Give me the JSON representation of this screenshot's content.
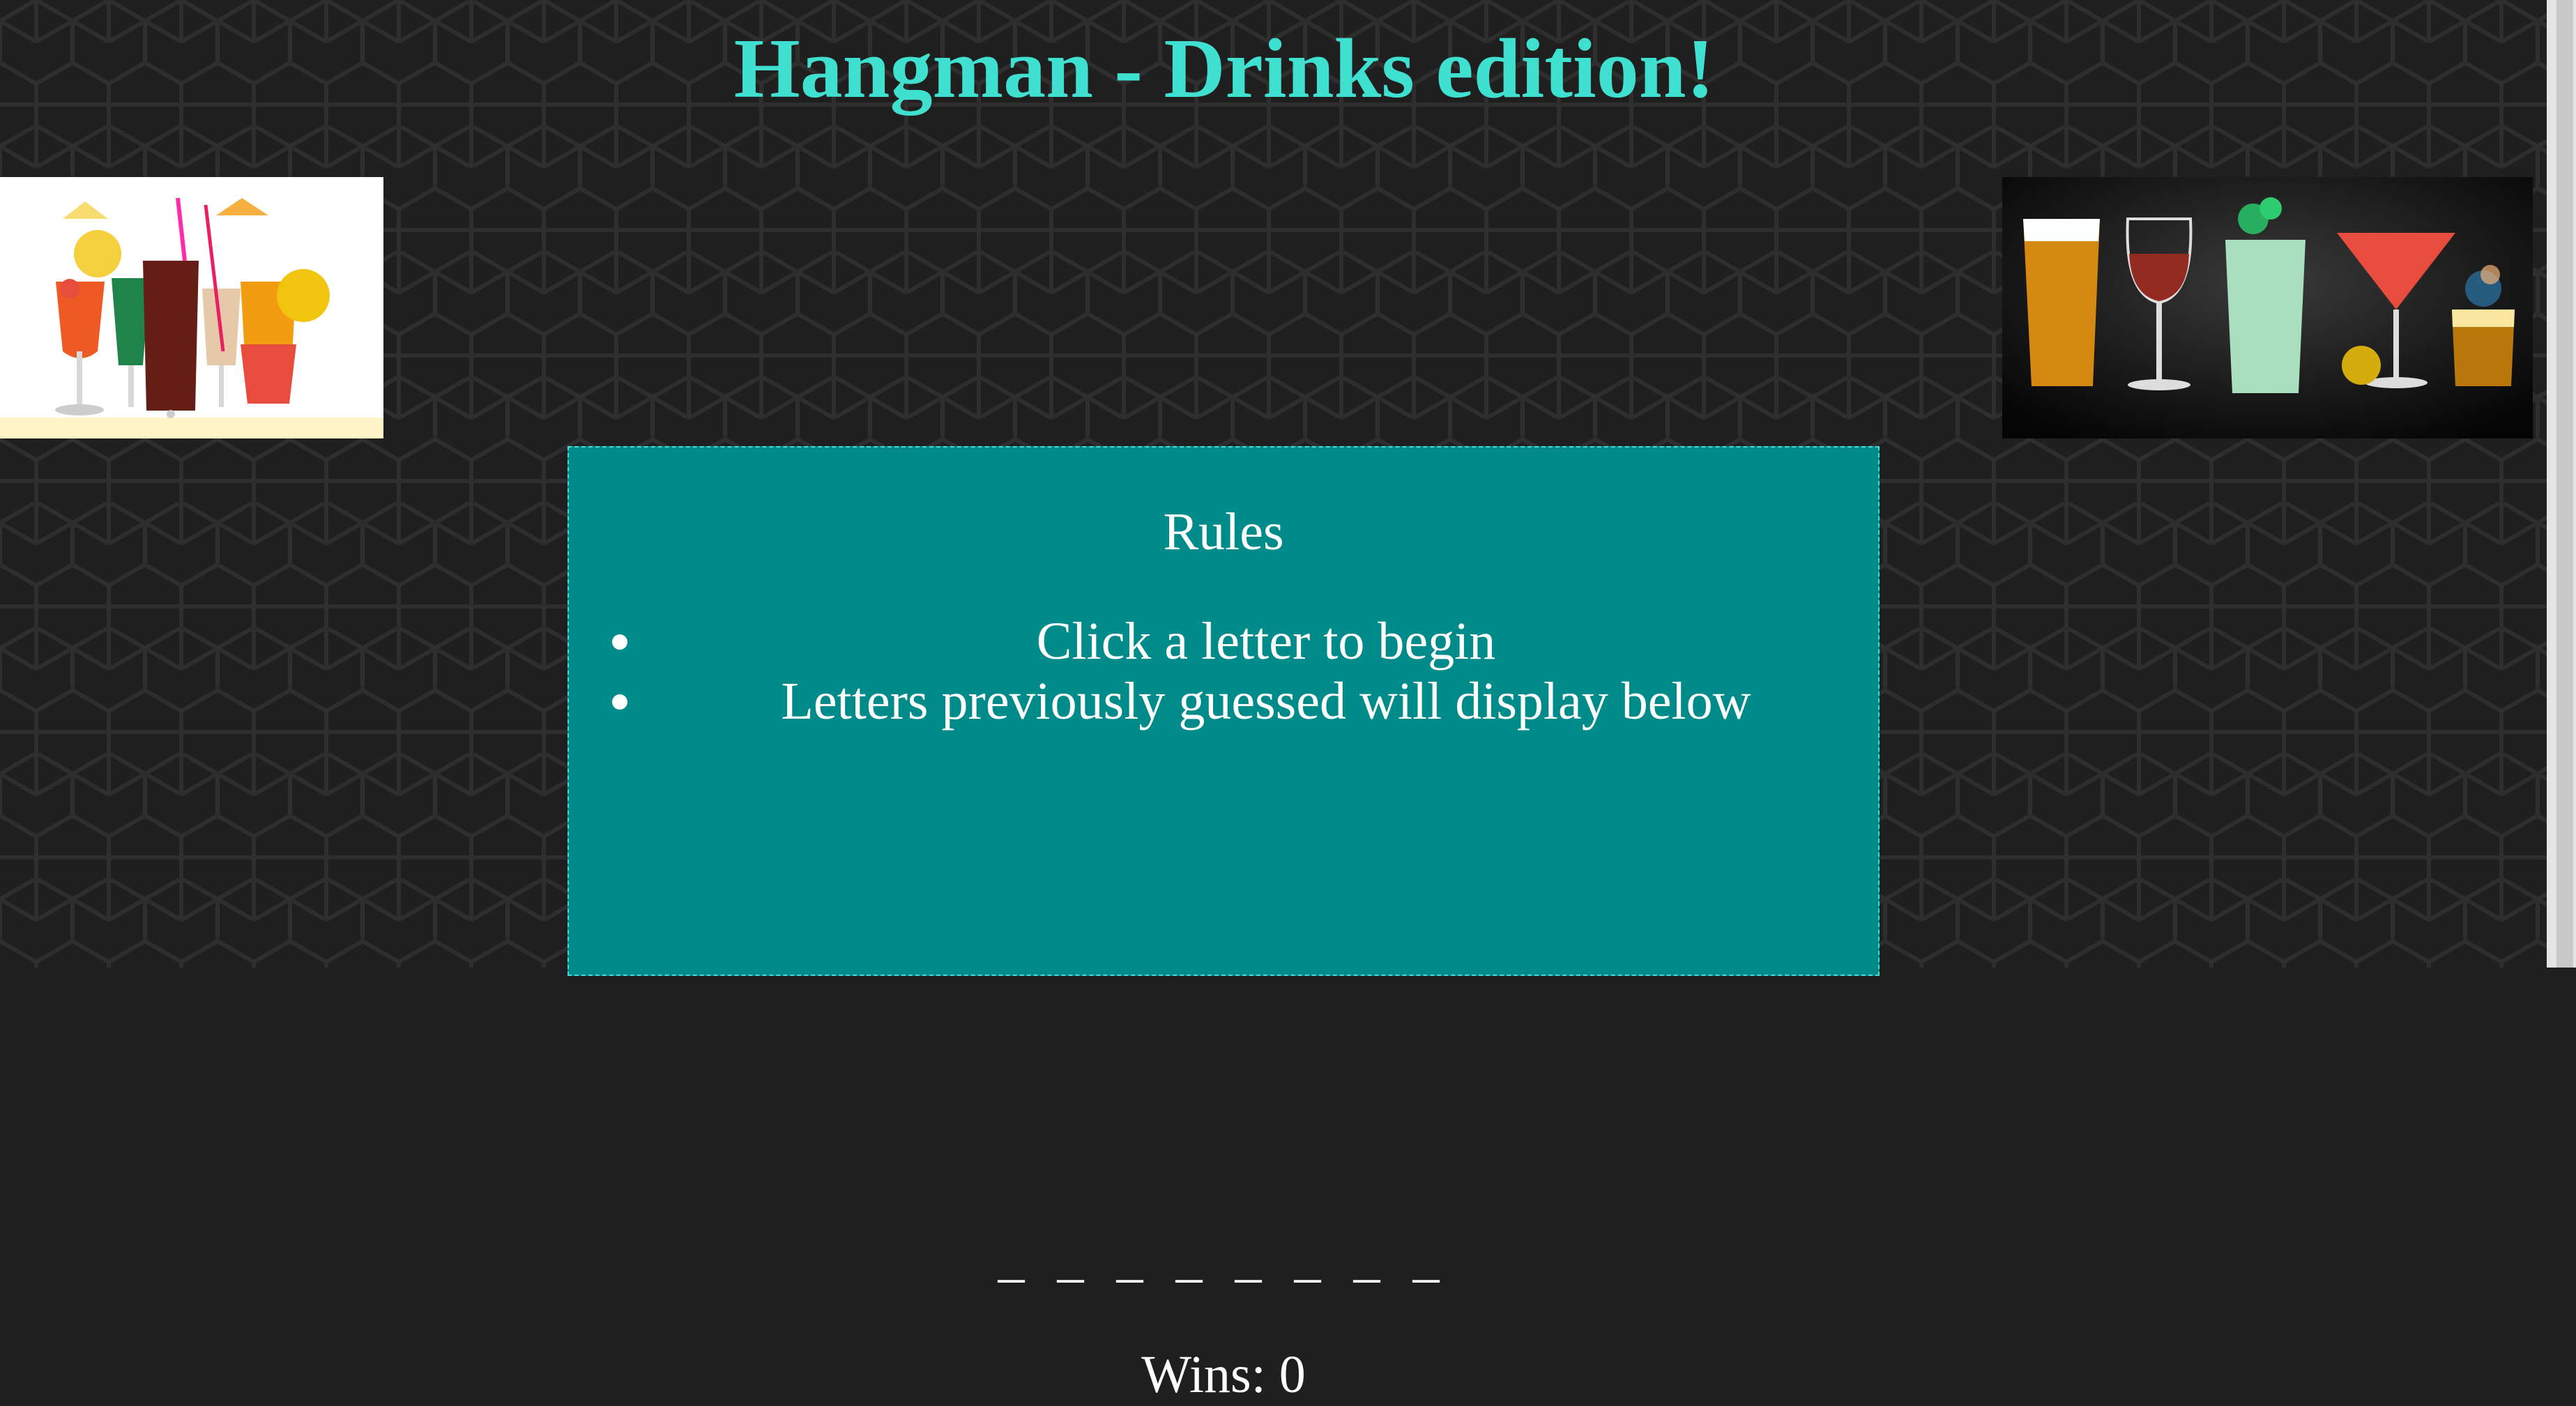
{
  "header": {
    "title": "Hangman - Drinks edition!"
  },
  "images": {
    "left": "cocktails-photo",
    "right": "assorted-drinks-photo"
  },
  "rules": {
    "heading": "Rules",
    "items": [
      "Click a letter to begin",
      "Letters previously guessed will display below"
    ]
  },
  "game": {
    "word_display": "_ _ _ _ _ _ _ _",
    "wins_label": "Wins: 0"
  },
  "colors": {
    "title": "#40e0d0",
    "panel": "#008b8b",
    "background": "#1f1f1f"
  }
}
